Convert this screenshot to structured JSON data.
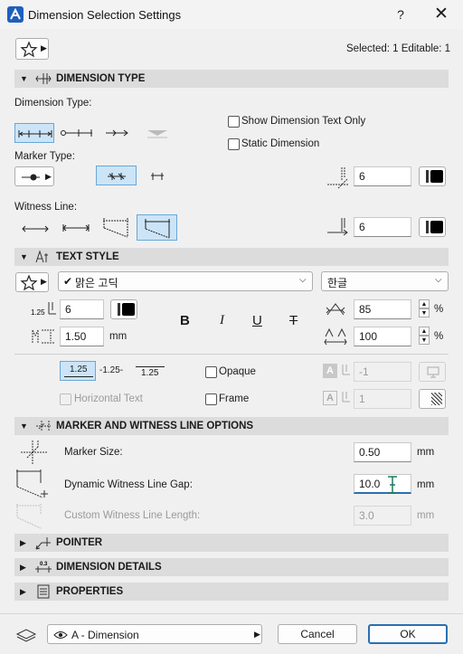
{
  "window": {
    "title": "Dimension Selection Settings"
  },
  "top": {
    "selected_info": "Selected: 1 Editable: 1"
  },
  "dimension_type": {
    "header": "DIMENSION TYPE",
    "type_label": "Dimension Type:",
    "show_text_only": "Show Dimension Text Only",
    "static_dimension": "Static Dimension",
    "marker_label": "Marker Type:",
    "marker_size_value": "6",
    "witness_label": "Witness Line:",
    "witness_value": "6"
  },
  "text_style": {
    "header": "TEXT STYLE",
    "font_name": "맑은 고딕",
    "font_script": "한글",
    "size_value": "6",
    "width_value": "85",
    "height_value": "1.50",
    "height_unit": "mm",
    "spacing_value": "100",
    "percent": "%",
    "pos_label_a": "1.25",
    "pos_label_b": "-1.25-",
    "pos_label_c": "1.25",
    "opaque": "Opaque",
    "frame": "Frame",
    "horizontal_text": "Horizontal Text",
    "pen_value_1": "-1",
    "pen_value_2": "1",
    "bold": "B",
    "italic": "I",
    "underline": "U",
    "strike": "T"
  },
  "marker_options": {
    "header": "MARKER AND WITNESS LINE OPTIONS",
    "marker_size_label": "Marker Size:",
    "marker_size_value": "0.50",
    "gap_label": "Dynamic Witness Line Gap:",
    "gap_value": "10.0",
    "custom_label": "Custom Witness Line Length:",
    "custom_value": "3.0",
    "unit": "mm"
  },
  "pointer": {
    "header": "POINTER"
  },
  "details": {
    "header": "DIMENSION DETAILS"
  },
  "properties": {
    "header": "PROPERTIES"
  },
  "footer": {
    "layer": "A - Dimension",
    "cancel": "Cancel",
    "ok": "OK"
  },
  "icons": {
    "help": "?",
    "close": "✕"
  }
}
